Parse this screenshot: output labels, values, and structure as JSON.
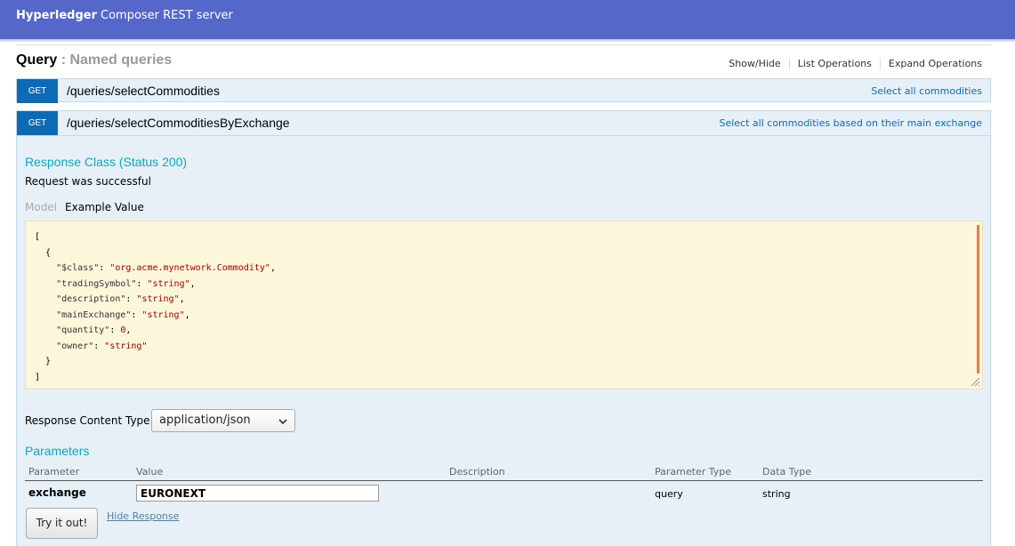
{
  "app": {
    "brand_bold": "Hyperledger",
    "brand_rest": "Composer REST server"
  },
  "section": {
    "name": "Query",
    "separator": " : ",
    "description": "Named queries",
    "ops": [
      "Show/Hide",
      "List Operations",
      "Expand Operations"
    ]
  },
  "operations": [
    {
      "method": "GET",
      "path": "/queries/selectCommodities",
      "summary": "Select all commodities"
    },
    {
      "method": "GET",
      "path": "/queries/selectCommoditiesByExchange",
      "summary": "Select all commodities based on their main exchange"
    }
  ],
  "response": {
    "title": "Response Class (Status 200)",
    "description": "Request was successful",
    "tab_model": "Model",
    "tab_example": "Example Value",
    "example_lines": [
      "[",
      "  {",
      "    \"$class\": \"org.acme.mynetwork.Commodity\",",
      "    \"tradingSymbol\": \"string\",",
      "    \"description\": \"string\",",
      "    \"mainExchange\": \"string\",",
      "    \"quantity\": 0,",
      "    \"owner\": \"string\"",
      "  }",
      "]"
    ],
    "content_type_label": "Response Content Type",
    "content_type_value": "application/json"
  },
  "parameters": {
    "title": "Parameters",
    "headers": {
      "parameter": "Parameter",
      "value": "Value",
      "description": "Description",
      "parameter_type": "Parameter Type",
      "data_type": "Data Type"
    },
    "rows": [
      {
        "name": "exchange",
        "value": "EURONEXT",
        "description": "",
        "parameter_type": "query",
        "data_type": "string"
      }
    ]
  },
  "actions": {
    "try_label": "Try it out!",
    "hide_label": "Hide Response"
  },
  "colors": {
    "topbar": "#5567c9",
    "get_badge": "#0f6ab4",
    "op_background": "#e7f0f7",
    "section_title": "#10a5c0",
    "code_background": "#fcf6db",
    "scrollbar": "#f07b45"
  }
}
